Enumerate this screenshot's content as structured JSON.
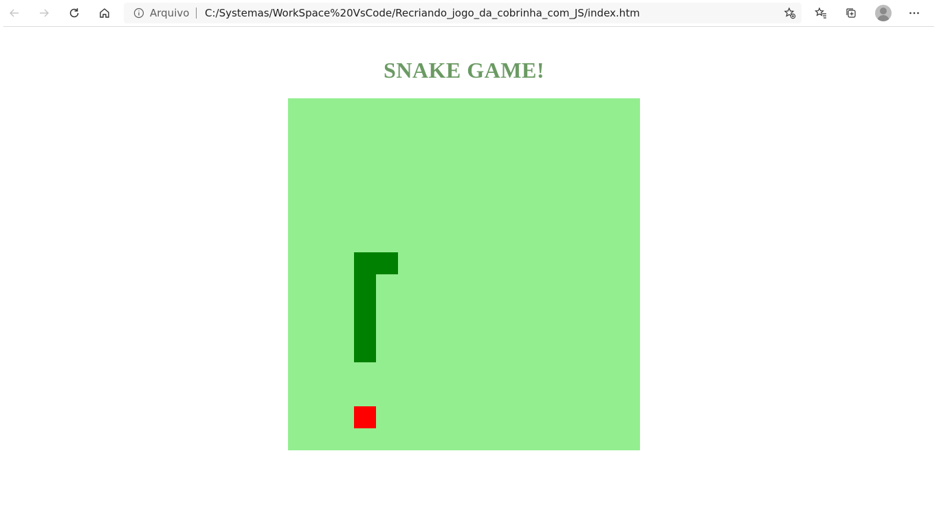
{
  "browser": {
    "address_bar": {
      "scheme_label": "Arquivo",
      "url": "C:/Systemas/WorkSpace%20VsCode/Recriando_jogo_da_cobrinha_com_JS/index.htm"
    },
    "icons": [
      "back-icon",
      "forward-icon",
      "refresh-icon",
      "home-icon",
      "info-icon",
      "add-favorite-icon",
      "favorites-icon",
      "collections-icon",
      "profile-avatar",
      "more-icon"
    ]
  },
  "page": {
    "title": "SNAKE GAME!"
  },
  "game": {
    "grid_cells": 16,
    "board_color": "#93ee90",
    "snake_color": "#008000",
    "food_color": "#ff0000",
    "snake": [
      {
        "col": 3,
        "row": 7
      },
      {
        "col": 4,
        "row": 7
      },
      {
        "col": 3,
        "row": 8
      },
      {
        "col": 3,
        "row": 9
      },
      {
        "col": 3,
        "row": 10
      },
      {
        "col": 3,
        "row": 11
      }
    ],
    "food": {
      "col": 3,
      "row": 14
    }
  }
}
